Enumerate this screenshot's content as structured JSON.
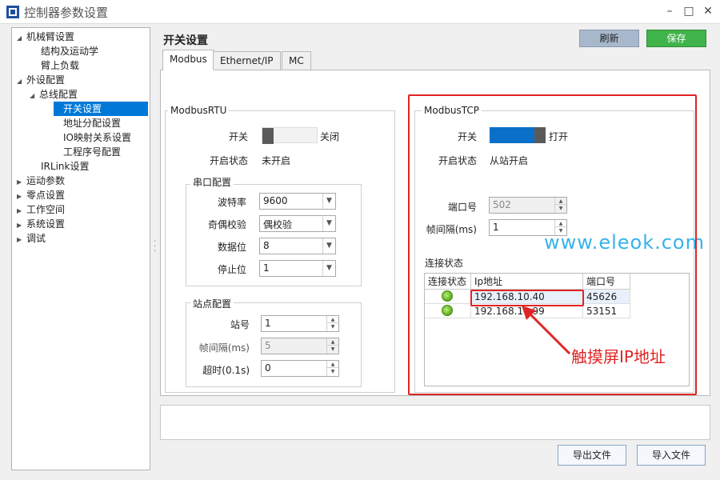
{
  "window": {
    "title": "控制器参数设置"
  },
  "tree": [
    {
      "label": "机械臂设置",
      "indent": 0,
      "arrow": "down"
    },
    {
      "label": "结构及运动学",
      "indent": 2,
      "arrow": ""
    },
    {
      "label": "臂上负载",
      "indent": 2,
      "arrow": ""
    },
    {
      "label": "外设配置",
      "indent": 0,
      "arrow": "down"
    },
    {
      "label": "总线配置",
      "indent": 1,
      "arrow": "down"
    },
    {
      "label": "开关设置",
      "indent": 3,
      "arrow": "",
      "selected": true
    },
    {
      "label": "地址分配设置",
      "indent": 3,
      "arrow": ""
    },
    {
      "label": "IO映射关系设置",
      "indent": 3,
      "arrow": ""
    },
    {
      "label": "工程序号配置",
      "indent": 3,
      "arrow": ""
    },
    {
      "label": "IRLink设置",
      "indent": 2,
      "arrow": ""
    },
    {
      "label": "运动参数",
      "indent": 0,
      "arrow": "right"
    },
    {
      "label": "零点设置",
      "indent": 0,
      "arrow": "right"
    },
    {
      "label": "工作空间",
      "indent": 0,
      "arrow": "right"
    },
    {
      "label": "系统设置",
      "indent": 0,
      "arrow": "right"
    },
    {
      "label": "调试",
      "indent": 0,
      "arrow": "right"
    }
  ],
  "header": {
    "title": "开关设置",
    "refresh_label": "刷新",
    "save_label": "保存"
  },
  "tabs": [
    "Modbus",
    "Ethernet/IP",
    "MC"
  ],
  "modbus_rtu": {
    "title": "ModbusRTU",
    "switch_label": "开关",
    "switch_state": "关闭",
    "open_status_label": "开启状态",
    "open_status_value": "未开启",
    "serial": {
      "title": "串口配置",
      "baud_label": "波特率",
      "baud_value": "9600",
      "parity_label": "奇偶校验",
      "parity_value": "偶校验",
      "databits_label": "数据位",
      "databits_value": "8",
      "stopbits_label": "停止位",
      "stopbits_value": "1"
    },
    "station": {
      "title": "站点配置",
      "id_label": "站号",
      "id_value": "1",
      "interval_label": "帧间隔(ms)",
      "interval_value": "5",
      "timeout_label": "超时(0.1s)",
      "timeout_value": "0"
    }
  },
  "modbus_tcp": {
    "title": "ModbusTCP",
    "switch_label": "开关",
    "switch_state": "打开",
    "open_status_label": "开启状态",
    "open_status_value": "从站开启",
    "port_label": "端口号",
    "port_value": "502",
    "interval_label": "帧间隔(ms)",
    "interval_value": "1",
    "conn_label": "连接状态",
    "columns": [
      "连接状态",
      "Ip地址",
      "端口号"
    ],
    "rows": [
      {
        "ip": "192.168.10.40",
        "port": "45626"
      },
      {
        "ip": "192.168.10.99",
        "port": "53151"
      }
    ]
  },
  "annotation": "触摸屏IP地址",
  "watermark": "www.eleok.com",
  "footer": {
    "export_label": "导出文件",
    "import_label": "导入文件"
  }
}
